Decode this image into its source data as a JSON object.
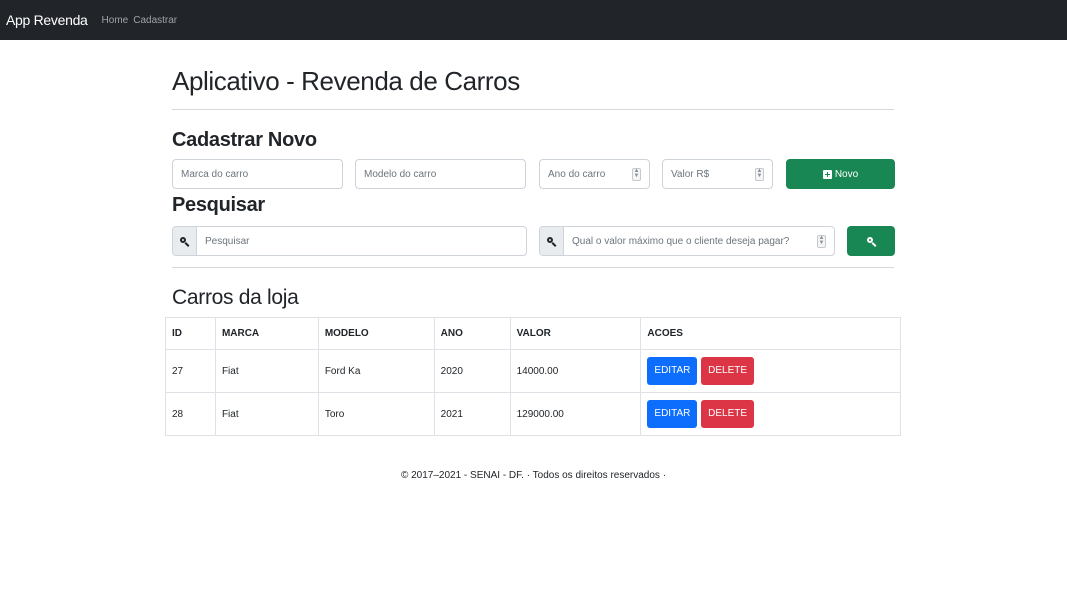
{
  "navbar": {
    "brand": "App Revenda",
    "links": [
      "Home",
      "Cadastrar"
    ]
  },
  "page_title": "Aplicativo - Revenda de Carros",
  "cadastro": {
    "heading": "Cadastrar Novo",
    "marca_placeholder": "Marca do carro",
    "modelo_placeholder": "Modelo do carro",
    "ano_placeholder": "Ano do carro",
    "valor_placeholder": "Valor R$",
    "novo_label": "Novo"
  },
  "pesquisa": {
    "heading": "Pesquisar",
    "search_placeholder": "Pesquisar",
    "max_placeholder": "Qual o valor máximo que o cliente deseja pagar?"
  },
  "tabela": {
    "heading": "Carros da loja",
    "columns": [
      "ID",
      "MARCA",
      "MODELO",
      "ANO",
      "VALOR",
      "ACOES"
    ],
    "rows": [
      {
        "id": "27",
        "marca": "Fiat",
        "modelo": "Ford Ka",
        "ano": "2020",
        "valor": "14000.00"
      },
      {
        "id": "28",
        "marca": "Fiat",
        "modelo": "Toro",
        "ano": "2021",
        "valor": "129000.00"
      }
    ],
    "edit_label": "EDITAR",
    "delete_label": "DELETE"
  },
  "footer": "© 2017–2021 - SENAI - DF. · Todos os direitos reservados ·",
  "colors": {
    "navbar": "#212529",
    "success": "#198754",
    "primary": "#0d6efd",
    "danger": "#dc3545"
  }
}
